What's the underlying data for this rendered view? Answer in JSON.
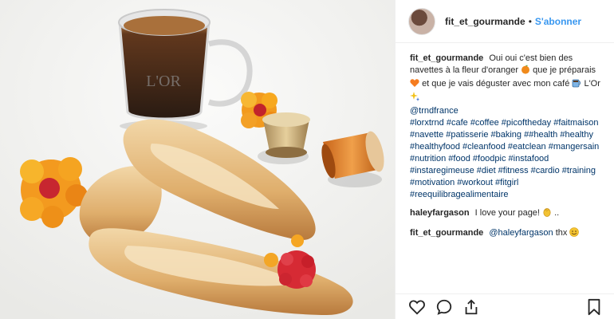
{
  "header": {
    "username": "fit_et_gourmande",
    "separator": "•",
    "follow_label": "S'abonner"
  },
  "caption": {
    "username": "fit_et_gourmande",
    "text_1": "Oui oui c'est bien des navettes à la fleur d'oranger",
    "text_2": "que je préparais",
    "text_3": "et que je vais déguster avec mon café",
    "text_4": "L'Or",
    "mention": "@trndfrance",
    "hashtags": "#lorxtrnd #cafe #coffee #picoftheday #faitmaison #navette #patisserie #baking ##health #healthy #healthyfood #cleanfood #eatclean #mangersain #nutrition #food #foodpic #instafood #instaregimeuse #diet #fitness #cardio #training #motivation #workout #fitgirl #reequilibragealimentaire"
  },
  "comments": [
    {
      "username": "haleyfargason",
      "text": "I love your page!",
      "suffix": ".."
    },
    {
      "username": "fit_et_gourmande",
      "mention": "@haleyfargason",
      "text": "thx"
    }
  ],
  "image": {
    "cup_logo": "L'OR"
  },
  "icons": {
    "like": "heart-icon",
    "comment": "comment-icon",
    "share": "share-icon",
    "save": "bookmark-icon"
  }
}
